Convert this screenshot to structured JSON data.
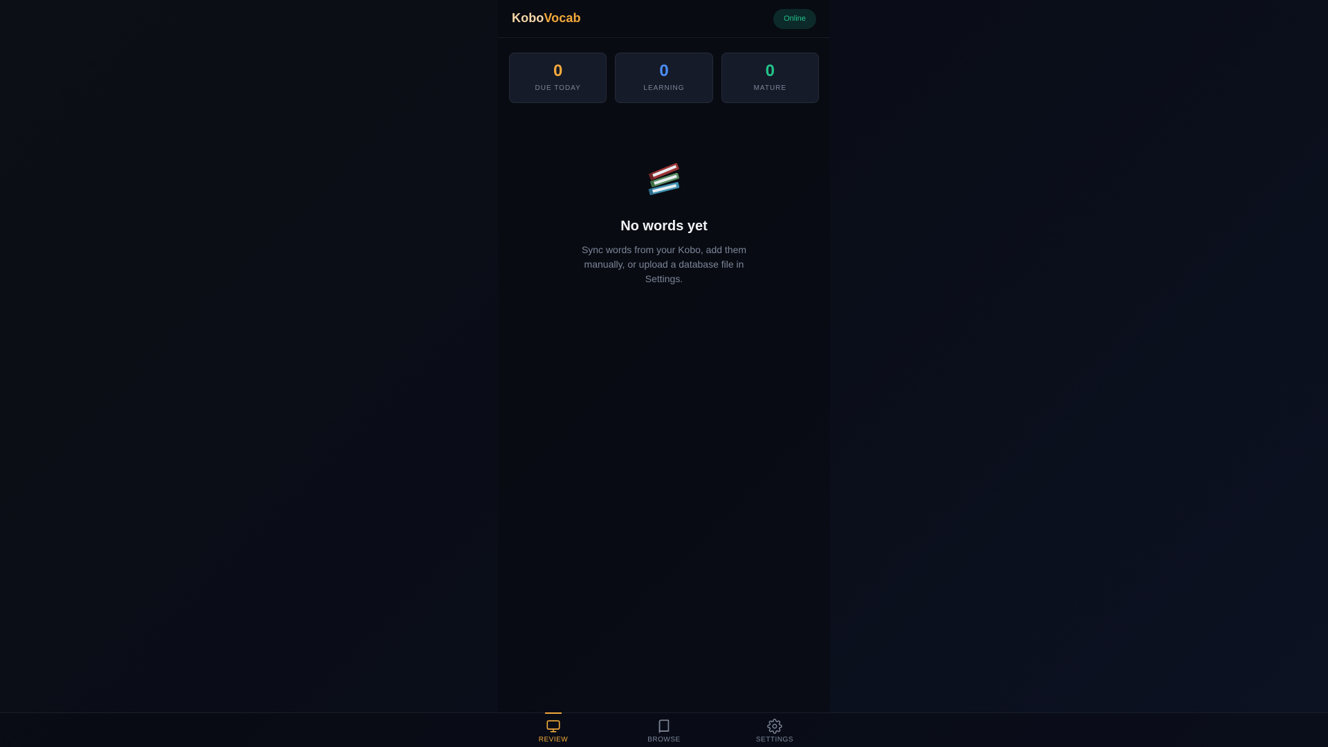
{
  "header": {
    "logo_part1": "Kobo",
    "logo_part2": "Vocab",
    "status": "Online"
  },
  "stats": [
    {
      "value": "0",
      "label": "DUE TODAY",
      "color": "#f2a93b"
    },
    {
      "value": "0",
      "label": "LEARNING",
      "color": "#4b8ef5"
    },
    {
      "value": "0",
      "label": "MATURE",
      "color": "#22c48a"
    }
  ],
  "empty_state": {
    "icon": "books-icon",
    "title": "No words yet",
    "text": "Sync words from your Kobo, add them manually, or upload a database file in Settings."
  },
  "nav": {
    "items": [
      {
        "label": "REVIEW",
        "icon": "monitor-icon",
        "active": true
      },
      {
        "label": "BROWSE",
        "icon": "book-icon",
        "active": false
      },
      {
        "label": "SETTINGS",
        "icon": "gear-icon",
        "active": false
      }
    ]
  },
  "colors": {
    "accent": "#f2a93b",
    "status_green": "#22c48a",
    "learning_blue": "#4b8ef5"
  }
}
